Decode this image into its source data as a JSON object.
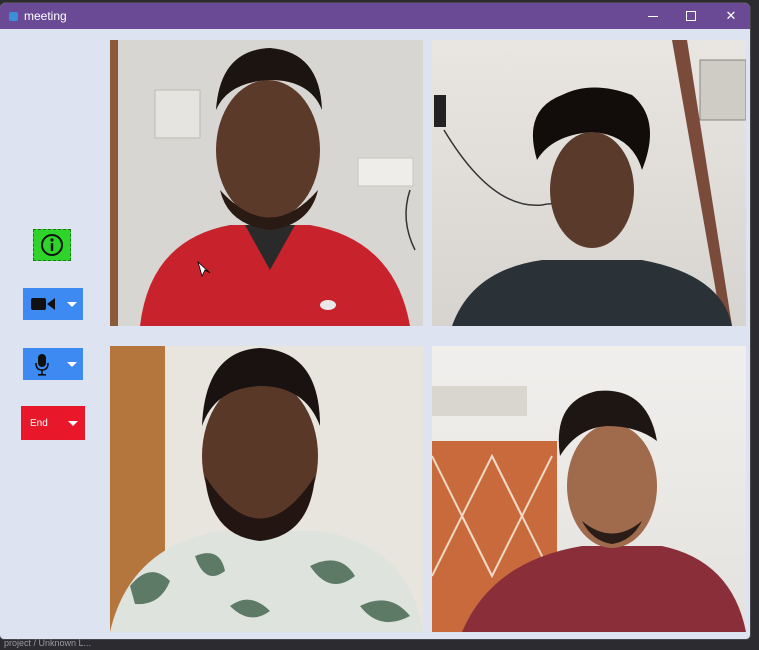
{
  "window": {
    "title": "meeting",
    "title_bar_color": "#6a4a95",
    "background_color": "#dde3f0",
    "controls": {
      "minimize_icon": "minimize-icon",
      "maximize_icon": "maximize-icon",
      "close_icon": "close-icon"
    }
  },
  "sidebar": {
    "info_button": {
      "icon": "info-icon",
      "color": "#2fd42a"
    },
    "camera_button": {
      "icon": "video-camera-icon",
      "dropdown_icon": "chevron-down-icon",
      "color": "#3d8bf2"
    },
    "mic_button": {
      "icon": "microphone-icon",
      "dropdown_icon": "chevron-down-icon",
      "color": "#3d8bf2"
    },
    "end_button": {
      "label": "End",
      "dropdown_icon": "chevron-down-icon",
      "color": "#e8182a"
    }
  },
  "video_tiles": [
    {
      "participant": "participant-1",
      "shirt_color": "#c8232c"
    },
    {
      "participant": "participant-2",
      "shirt_color": "#2a3238"
    },
    {
      "participant": "participant-3",
      "shirt_color": "#dfe3de"
    },
    {
      "participant": "participant-4",
      "shirt_color": "#8a2e3a"
    }
  ],
  "taskbar": {
    "text": "project /    Unknown L..."
  }
}
